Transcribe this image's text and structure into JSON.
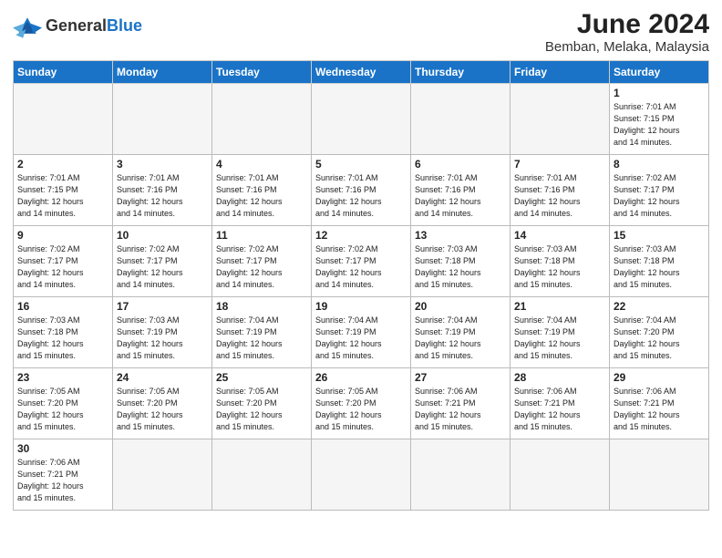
{
  "logo": {
    "text_general": "General",
    "text_blue": "Blue"
  },
  "header": {
    "title": "June 2024",
    "subtitle": "Bemban, Melaka, Malaysia"
  },
  "weekdays": [
    "Sunday",
    "Monday",
    "Tuesday",
    "Wednesday",
    "Thursday",
    "Friday",
    "Saturday"
  ],
  "weeks": [
    [
      {
        "day": "",
        "info": ""
      },
      {
        "day": "",
        "info": ""
      },
      {
        "day": "",
        "info": ""
      },
      {
        "day": "",
        "info": ""
      },
      {
        "day": "",
        "info": ""
      },
      {
        "day": "",
        "info": ""
      },
      {
        "day": "1",
        "info": "Sunrise: 7:01 AM\nSunset: 7:15 PM\nDaylight: 12 hours\nand 14 minutes."
      }
    ],
    [
      {
        "day": "2",
        "info": "Sunrise: 7:01 AM\nSunset: 7:15 PM\nDaylight: 12 hours\nand 14 minutes."
      },
      {
        "day": "3",
        "info": "Sunrise: 7:01 AM\nSunset: 7:16 PM\nDaylight: 12 hours\nand 14 minutes."
      },
      {
        "day": "4",
        "info": "Sunrise: 7:01 AM\nSunset: 7:16 PM\nDaylight: 12 hours\nand 14 minutes."
      },
      {
        "day": "5",
        "info": "Sunrise: 7:01 AM\nSunset: 7:16 PM\nDaylight: 12 hours\nand 14 minutes."
      },
      {
        "day": "6",
        "info": "Sunrise: 7:01 AM\nSunset: 7:16 PM\nDaylight: 12 hours\nand 14 minutes."
      },
      {
        "day": "7",
        "info": "Sunrise: 7:01 AM\nSunset: 7:16 PM\nDaylight: 12 hours\nand 14 minutes."
      },
      {
        "day": "8",
        "info": "Sunrise: 7:02 AM\nSunset: 7:17 PM\nDaylight: 12 hours\nand 14 minutes."
      }
    ],
    [
      {
        "day": "9",
        "info": "Sunrise: 7:02 AM\nSunset: 7:17 PM\nDaylight: 12 hours\nand 14 minutes."
      },
      {
        "day": "10",
        "info": "Sunrise: 7:02 AM\nSunset: 7:17 PM\nDaylight: 12 hours\nand 14 minutes."
      },
      {
        "day": "11",
        "info": "Sunrise: 7:02 AM\nSunset: 7:17 PM\nDaylight: 12 hours\nand 14 minutes."
      },
      {
        "day": "12",
        "info": "Sunrise: 7:02 AM\nSunset: 7:17 PM\nDaylight: 12 hours\nand 14 minutes."
      },
      {
        "day": "13",
        "info": "Sunrise: 7:03 AM\nSunset: 7:18 PM\nDaylight: 12 hours\nand 15 minutes."
      },
      {
        "day": "14",
        "info": "Sunrise: 7:03 AM\nSunset: 7:18 PM\nDaylight: 12 hours\nand 15 minutes."
      },
      {
        "day": "15",
        "info": "Sunrise: 7:03 AM\nSunset: 7:18 PM\nDaylight: 12 hours\nand 15 minutes."
      }
    ],
    [
      {
        "day": "16",
        "info": "Sunrise: 7:03 AM\nSunset: 7:18 PM\nDaylight: 12 hours\nand 15 minutes."
      },
      {
        "day": "17",
        "info": "Sunrise: 7:03 AM\nSunset: 7:19 PM\nDaylight: 12 hours\nand 15 minutes."
      },
      {
        "day": "18",
        "info": "Sunrise: 7:04 AM\nSunset: 7:19 PM\nDaylight: 12 hours\nand 15 minutes."
      },
      {
        "day": "19",
        "info": "Sunrise: 7:04 AM\nSunset: 7:19 PM\nDaylight: 12 hours\nand 15 minutes."
      },
      {
        "day": "20",
        "info": "Sunrise: 7:04 AM\nSunset: 7:19 PM\nDaylight: 12 hours\nand 15 minutes."
      },
      {
        "day": "21",
        "info": "Sunrise: 7:04 AM\nSunset: 7:19 PM\nDaylight: 12 hours\nand 15 minutes."
      },
      {
        "day": "22",
        "info": "Sunrise: 7:04 AM\nSunset: 7:20 PM\nDaylight: 12 hours\nand 15 minutes."
      }
    ],
    [
      {
        "day": "23",
        "info": "Sunrise: 7:05 AM\nSunset: 7:20 PM\nDaylight: 12 hours\nand 15 minutes."
      },
      {
        "day": "24",
        "info": "Sunrise: 7:05 AM\nSunset: 7:20 PM\nDaylight: 12 hours\nand 15 minutes."
      },
      {
        "day": "25",
        "info": "Sunrise: 7:05 AM\nSunset: 7:20 PM\nDaylight: 12 hours\nand 15 minutes."
      },
      {
        "day": "26",
        "info": "Sunrise: 7:05 AM\nSunset: 7:20 PM\nDaylight: 12 hours\nand 15 minutes."
      },
      {
        "day": "27",
        "info": "Sunrise: 7:06 AM\nSunset: 7:21 PM\nDaylight: 12 hours\nand 15 minutes."
      },
      {
        "day": "28",
        "info": "Sunrise: 7:06 AM\nSunset: 7:21 PM\nDaylight: 12 hours\nand 15 minutes."
      },
      {
        "day": "29",
        "info": "Sunrise: 7:06 AM\nSunset: 7:21 PM\nDaylight: 12 hours\nand 15 minutes."
      }
    ],
    [
      {
        "day": "30",
        "info": "Sunrise: 7:06 AM\nSunset: 7:21 PM\nDaylight: 12 hours\nand 15 minutes."
      },
      {
        "day": "",
        "info": ""
      },
      {
        "day": "",
        "info": ""
      },
      {
        "day": "",
        "info": ""
      },
      {
        "day": "",
        "info": ""
      },
      {
        "day": "",
        "info": ""
      },
      {
        "day": "",
        "info": ""
      }
    ]
  ]
}
